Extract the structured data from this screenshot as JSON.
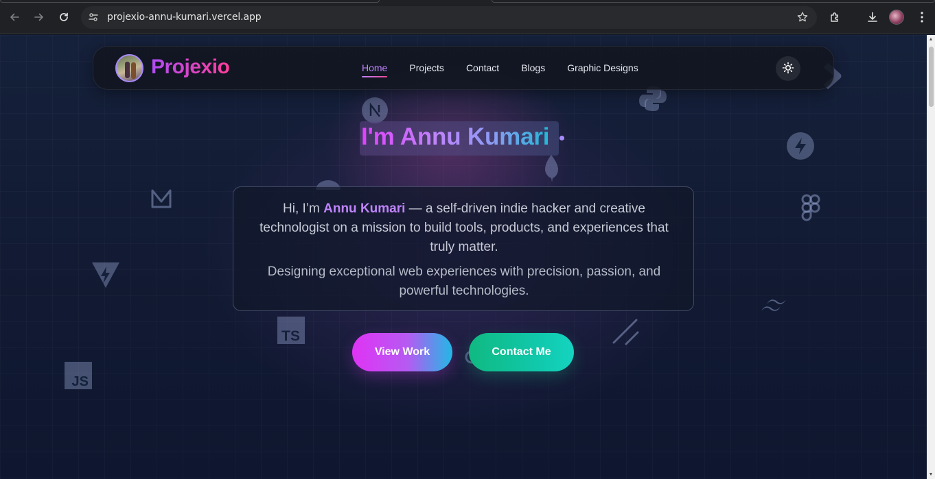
{
  "browser": {
    "url": "projexio-annu-kumari.vercel.app",
    "back_icon": "arrow-left-icon",
    "forward_icon": "arrow-right-icon",
    "reload_icon": "reload-icon",
    "site_info_icon": "tune-icon",
    "bookmark_icon": "star-icon",
    "extensions_icon": "puzzle-icon",
    "download_icon": "download-icon",
    "menu_icon": "kebab-menu-icon"
  },
  "navbar": {
    "brand": "Projexio",
    "links": [
      {
        "label": "Home",
        "active": true
      },
      {
        "label": "Projects",
        "active": false
      },
      {
        "label": "Contact",
        "active": false
      },
      {
        "label": "Blogs",
        "active": false
      },
      {
        "label": "Graphic Designs",
        "active": false
      }
    ],
    "theme_icon": "sun-icon"
  },
  "hero": {
    "title": "I'm Annu Kumari",
    "intro_prefix": "Hi, I’m ",
    "intro_name": "Annu Kumari",
    "intro_suffix": " — a self-driven indie hacker and creative technologist on a mission to build tools, products, and experiences that truly matter.",
    "tagline": "Designing exceptional web experiences with precision, passion, and powerful technologies.",
    "primary_button": "View Work",
    "secondary_button": "Contact Me"
  },
  "decor_icons": [
    "nextjs-icon",
    "python-icon",
    "supabase-icon",
    "mongodb-icon",
    "figma-icon",
    "motion-icon",
    "vite-icon",
    "tailwind-icon",
    "typescript-icon",
    "javascript-icon",
    "shadcn-icon",
    "git-icon"
  ],
  "decor_labels": {
    "typescript": "TS",
    "javascript": "JS"
  },
  "colors": {
    "accent_purple": "#c084fc",
    "brand_pink": "#ff3d9a",
    "contact_green": "#10b981",
    "page_bg": "#121b33"
  }
}
